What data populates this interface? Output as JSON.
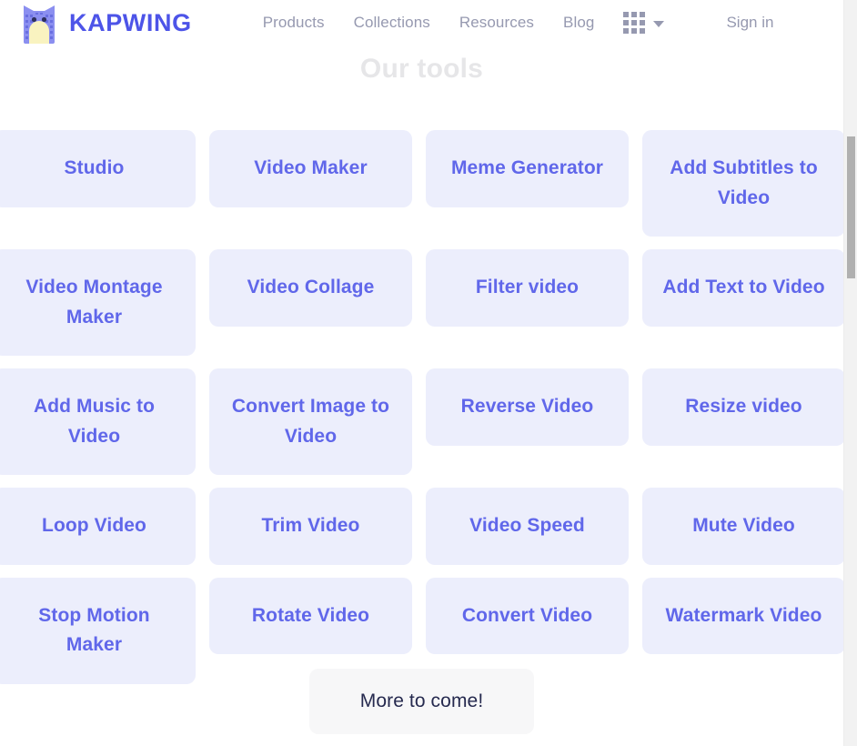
{
  "nav": {
    "logo_icon": "cat-logo-icon",
    "brand": "KAPWING",
    "brand_color": "#4d54e8",
    "links": [
      {
        "label": "Products"
      },
      {
        "label": "Collections"
      },
      {
        "label": "Resources"
      },
      {
        "label": "Blog"
      }
    ],
    "apps_grid_icon": "grid-apps-icon",
    "apps_chevron_icon": "chevron-down-icon",
    "signin_label": "Sign in",
    "link_color": "#9699b0"
  },
  "main": {
    "section_title": "Our tools",
    "section_title_color": "#e6e6e8",
    "card_bg": "#eceefc",
    "card_text_color": "#6067ea",
    "tools": [
      {
        "label": "Studio",
        "tall": false
      },
      {
        "label": "Video Maker",
        "tall": false
      },
      {
        "label": "Meme Generator",
        "tall": false
      },
      {
        "label": "Add Subtitles to Video",
        "tall": true
      },
      {
        "label": "Video Montage Maker",
        "tall": true
      },
      {
        "label": "Video Collage",
        "tall": false
      },
      {
        "label": "Filter video",
        "tall": false
      },
      {
        "label": "Add Text to Video",
        "tall": false
      },
      {
        "label": "Add Music to Video",
        "tall": true
      },
      {
        "label": "Convert Image to Video",
        "tall": true
      },
      {
        "label": "Reverse Video",
        "tall": false
      },
      {
        "label": "Resize video",
        "tall": false
      },
      {
        "label": "Loop Video",
        "tall": false
      },
      {
        "label": "Trim Video",
        "tall": false
      },
      {
        "label": "Video Speed",
        "tall": false
      },
      {
        "label": "Mute Video",
        "tall": false
      },
      {
        "label": "Stop Motion Maker",
        "tall": true
      },
      {
        "label": "Rotate Video",
        "tall": false
      },
      {
        "label": "Convert Video",
        "tall": false
      },
      {
        "label": "Watermark Video",
        "tall": false
      }
    ],
    "more_button": "More to come!",
    "more_button_bg": "#f7f7f8",
    "more_button_color": "#262a4f"
  },
  "scrollbar": {
    "track_color": "#f2f2f2",
    "thumb_color": "#b0b0b0"
  }
}
